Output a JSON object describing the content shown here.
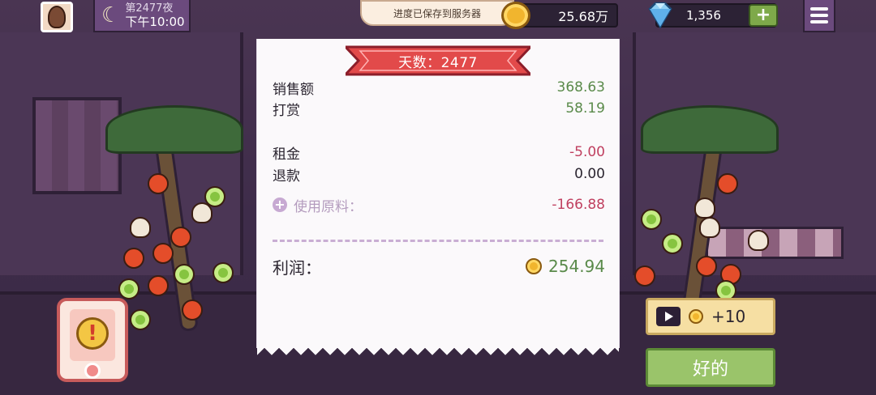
{
  "top_bar": {
    "night_label": "第2477夜",
    "time": "下午10:00",
    "toast": "进度已保存到服务器",
    "coins": "25.68万",
    "gems": "1,356",
    "gem_add": "+"
  },
  "receipt": {
    "ribbon": "天数：2477",
    "rows": [
      {
        "label": "销售额",
        "value": "368.63"
      },
      {
        "label": "打赏",
        "value": "58.19"
      },
      {
        "label": "租金",
        "value": "-5.00"
      },
      {
        "label": "退款",
        "value": "0.00"
      },
      {
        "label": "使用原料：",
        "value": "-166.88"
      }
    ],
    "profit_label": "利润：",
    "profit_value": "254.94"
  },
  "buttons": {
    "ad_reward": "+10",
    "ok": "好的"
  },
  "colors": {
    "green_value": "#5a8a4a",
    "red_value": "#c04060",
    "ok_button": "#9ac46a",
    "ribbon": "#e24a4a"
  }
}
